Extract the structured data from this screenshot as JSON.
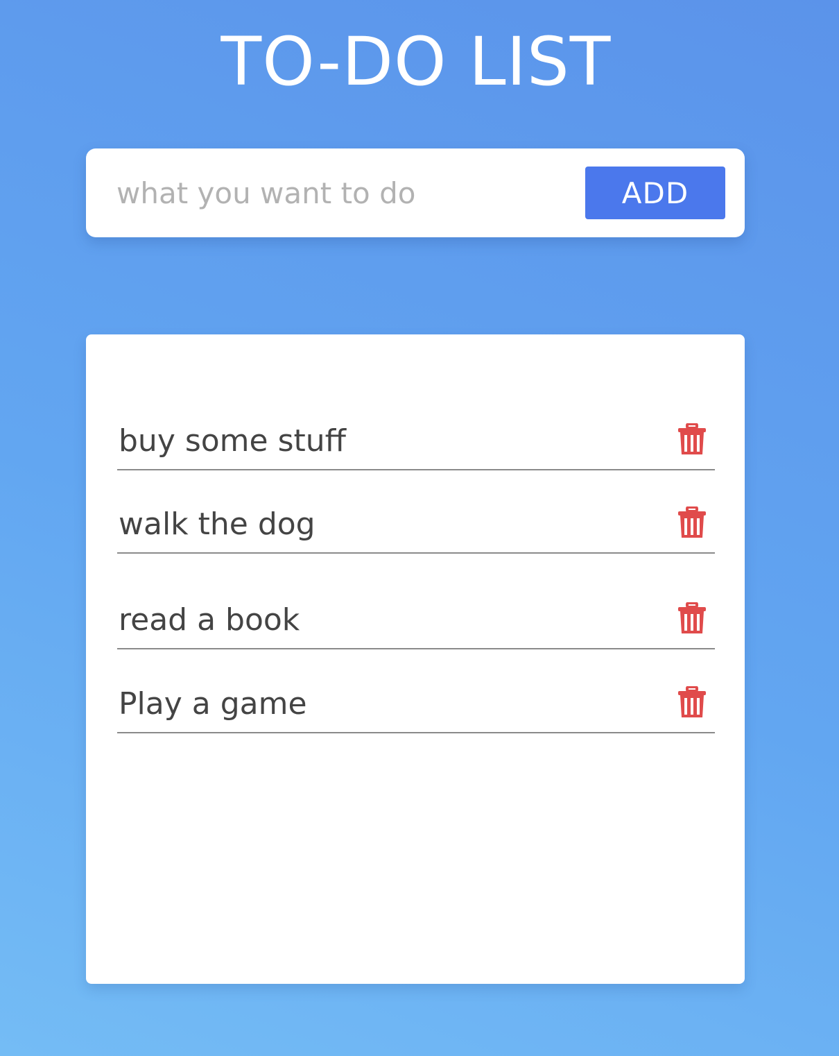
{
  "header": {
    "title": "TO-DO LIST"
  },
  "add_form": {
    "placeholder": "what you want to do",
    "value": "",
    "button_label": "ADD",
    "accent_color": "#4b78ec"
  },
  "todos": [
    {
      "text": "buy some stuff",
      "delete_icon": "trash-icon"
    },
    {
      "text": "walk the dog",
      "delete_icon": "trash-icon"
    },
    {
      "text": "read a book",
      "delete_icon": "trash-icon"
    },
    {
      "text": "Play a game",
      "delete_icon": "trash-icon"
    }
  ],
  "colors": {
    "delete": "#e04b4b",
    "background_start": "#74bcf5",
    "background_end": "#5b93ea"
  }
}
